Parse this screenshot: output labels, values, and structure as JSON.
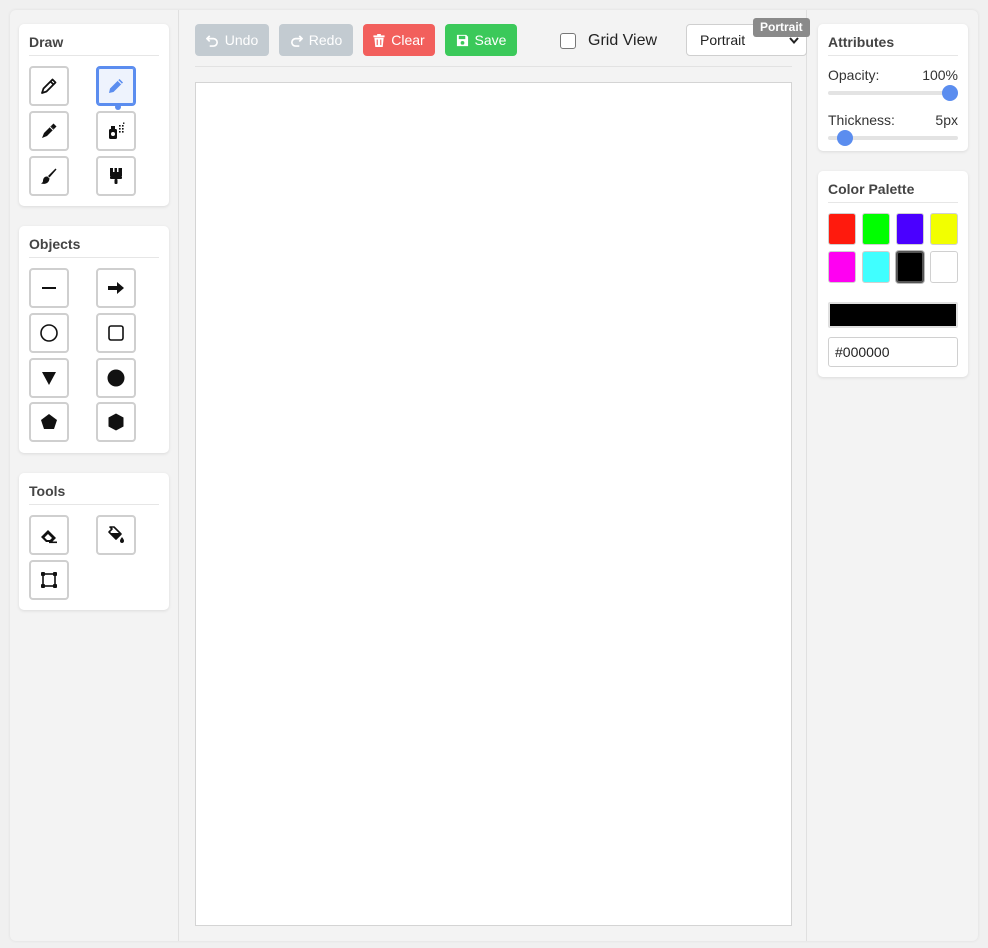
{
  "draw": {
    "title": "Draw",
    "tools": [
      {
        "name": "pencil-tool",
        "icon": "pencil-icon"
      },
      {
        "name": "pen-tool",
        "icon": "pen-icon",
        "active": true
      },
      {
        "name": "marker-tool",
        "icon": "marker-icon"
      },
      {
        "name": "spray-tool",
        "icon": "spray-can-icon"
      },
      {
        "name": "brush-tool",
        "icon": "paintbrush-icon"
      },
      {
        "name": "wide-brush-tool",
        "icon": "wide-brush-icon"
      }
    ]
  },
  "objects": {
    "title": "Objects",
    "tools": [
      {
        "name": "line-tool",
        "icon": "line-icon"
      },
      {
        "name": "arrow-tool",
        "icon": "arrow-right-icon"
      },
      {
        "name": "circle-outline-tool",
        "icon": "circle-outline-icon"
      },
      {
        "name": "square-outline-tool",
        "icon": "square-outline-icon"
      },
      {
        "name": "triangle-tool",
        "icon": "triangle-down-icon"
      },
      {
        "name": "circle-filled-tool",
        "icon": "circle-filled-icon"
      },
      {
        "name": "pentagon-tool",
        "icon": "pentagon-icon"
      },
      {
        "name": "hexagon-tool",
        "icon": "hexagon-icon"
      }
    ]
  },
  "tools": {
    "title": "Tools",
    "tools": [
      {
        "name": "eraser-tool",
        "icon": "eraser-icon"
      },
      {
        "name": "fill-tool",
        "icon": "paint-bucket-icon"
      },
      {
        "name": "select-tool",
        "icon": "vector-square-icon"
      }
    ]
  },
  "toolbar": {
    "undo_label": "Undo",
    "redo_label": "Redo",
    "clear_label": "Clear",
    "save_label": "Save",
    "grid_view_label": "Grid View",
    "grid_view_checked": false,
    "orientation_value": "Portrait",
    "tooltip": "Portrait"
  },
  "attributes": {
    "title": "Attributes",
    "opacity_label": "Opacity:",
    "opacity_value": "100%",
    "opacity_fraction": 1.0,
    "thickness_label": "Thickness:",
    "thickness_value": "5px",
    "thickness_fraction": 0.08
  },
  "palette": {
    "title": "Color Palette",
    "colors": [
      "#ff1a0d",
      "#00ff00",
      "#4a00ff",
      "#f2ff00",
      "#ff00f2",
      "#40ffff",
      "#000000",
      "#ffffff"
    ],
    "selected_index": 6,
    "current_color": "#000000",
    "hex_value": "#000000"
  }
}
